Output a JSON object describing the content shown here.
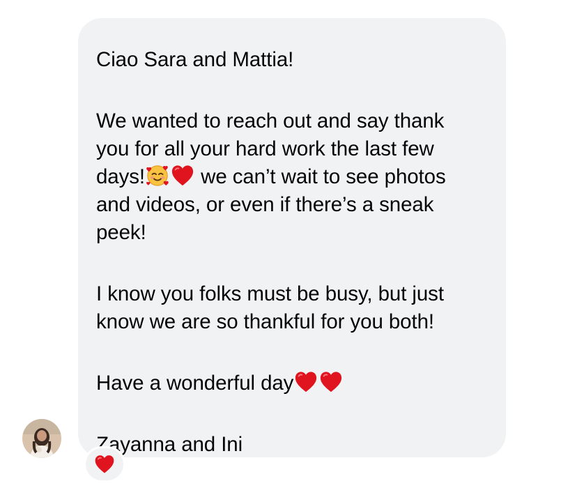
{
  "message": {
    "greeting": "Ciao Sara and Mattia!",
    "para1": {
      "line1": "We wanted to reach out and say thank",
      "line2": "you for all your hard work the last few",
      "line3_pre": "days!",
      "line3_post": " we can’t wait to see photos",
      "line4": "and videos, or even if there’s a sneak",
      "line5": "peek!"
    },
    "para2": {
      "line1": "I know you folks must be busy, but just",
      "line2": "know we are so thankful for you both!"
    },
    "closing": "Have a wonderful day",
    "signature": "Zayanna and Ini"
  },
  "emojis": {
    "para1": [
      "smiling-face-with-hearts-icon",
      "red-heart-icon"
    ],
    "closing": [
      "red-heart-icon",
      "red-heart-icon"
    ],
    "reaction": "red-heart-icon"
  },
  "colors": {
    "bubble": "#f1f2f4",
    "text": "#050505",
    "heart": "#e0141e",
    "background": "#ffffff"
  }
}
